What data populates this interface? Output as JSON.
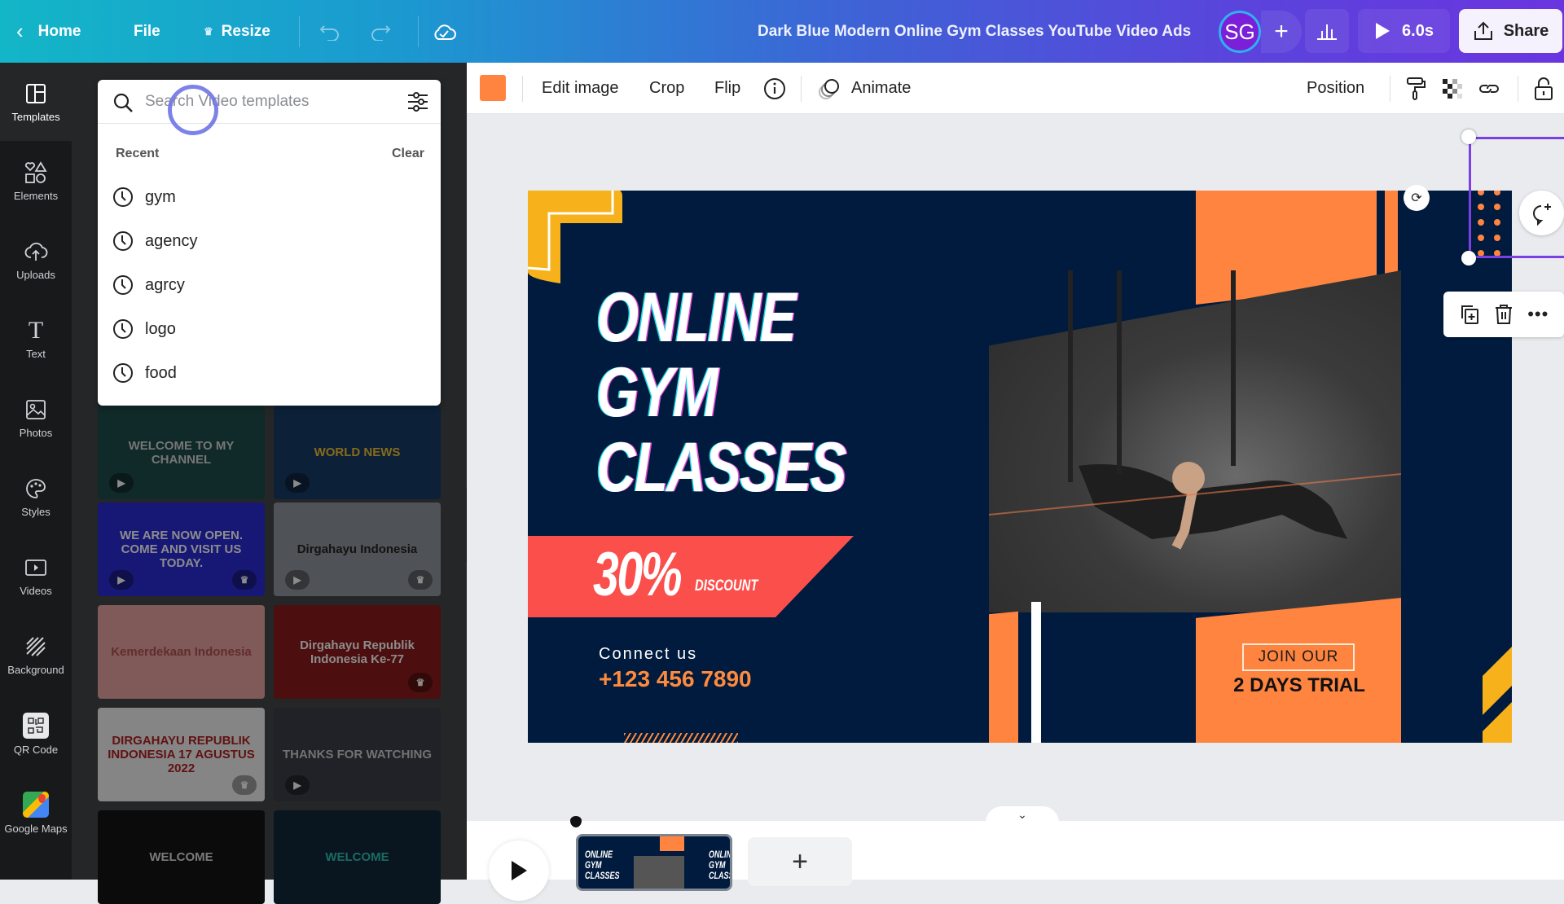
{
  "topbar": {
    "home_label": "Home",
    "file_label": "File",
    "resize_label": "Resize",
    "document_title": "Dark Blue Modern Online Gym Classes YouTube Video Ads",
    "avatar_initials": "SG",
    "play_duration": "6.0s",
    "share_label": "Share",
    "icons": [
      "chevron-left-icon",
      "crown-icon",
      "undo-icon",
      "redo-icon",
      "cloud-check-icon",
      "plus-icon",
      "stats-icon",
      "play-icon",
      "share-upload-icon"
    ]
  },
  "rail": {
    "items": [
      {
        "label": "Templates",
        "icon": "templates-icon",
        "active": true
      },
      {
        "label": "Elements",
        "icon": "elements-icon"
      },
      {
        "label": "Uploads",
        "icon": "upload-cloud-icon"
      },
      {
        "label": "Text",
        "icon": "text-icon"
      },
      {
        "label": "Photos",
        "icon": "photo-icon"
      },
      {
        "label": "Styles",
        "icon": "palette-icon"
      },
      {
        "label": "Videos",
        "icon": "video-icon"
      },
      {
        "label": "Background",
        "icon": "background-icon"
      },
      {
        "label": "QR Code",
        "icon": "qr-code-icon"
      },
      {
        "label": "Google Maps",
        "icon": "google-maps-icon"
      }
    ]
  },
  "search": {
    "placeholder": "Search Video templates",
    "value": "",
    "recent_header": "Recent",
    "clear_label": "Clear",
    "recent": [
      "gym",
      "agency",
      "agrcy",
      "logo",
      "food"
    ]
  },
  "templates": [
    {
      "text": "WELCOME TO MY CHANNEL",
      "bg": "#1d4a4a",
      "fg": "#d6d6d6",
      "play": true,
      "premium": false
    },
    {
      "text": "WORLD NEWS",
      "bg": "#163a66",
      "fg": "#f2c230",
      "play": true,
      "premium": false
    },
    {
      "text": "WE ARE NOW OPEN. COME AND VISIT US TODAY.",
      "bg": "#2a2ad6",
      "fg": "#ffffff",
      "play": true,
      "premium": true
    },
    {
      "text": "Dirgahayu Indonesia",
      "bg": "#8f969c",
      "fg": "#222222",
      "play": true,
      "premium": true
    },
    {
      "text": "Kemerdekaan Indonesia",
      "bg": "#e6a3a1",
      "fg": "#b45050",
      "play": false,
      "premium": false
    },
    {
      "text": "Dirgahayu Republik Indonesia Ke-77",
      "bg": "#8a1a1a",
      "fg": "#ffffff",
      "play": false,
      "premium": true
    },
    {
      "text": "DIRGAHAYU REPUBLIK INDONESIA 17 AGUSTUS 2022",
      "bg": "#f2f2f2",
      "fg": "#b02020",
      "play": false,
      "premium": true
    },
    {
      "text": "THANKS FOR WATCHING",
      "bg": "#3a3d48",
      "fg": "#cfcfcf",
      "play": true,
      "premium": false
    },
    {
      "text": "WELCOME",
      "bg": "#141414",
      "fg": "#dddddd",
      "play": false,
      "premium": false
    },
    {
      "text": "WELCOME",
      "bg": "#102838",
      "fg": "#2ec4b0",
      "play": false,
      "premium": false
    }
  ],
  "context_toolbar": {
    "swatch_color": "#ff8440",
    "edit_image": "Edit image",
    "crop": "Crop",
    "flip": "Flip",
    "animate": "Animate",
    "position": "Position",
    "icons": [
      "info-icon",
      "animate-icon",
      "paint-roller-icon",
      "transparency-icon",
      "link-icon",
      "unlock-icon"
    ]
  },
  "design": {
    "headline": [
      "ONLINE",
      "GYM",
      "CLASSES"
    ],
    "discount_percent": "30%",
    "discount_word": "DISCOUNT",
    "connect_label": "Connect us",
    "phone": "+123 456 7890",
    "join_label": "JOIN OUR",
    "trial_label": "2 DAYS TRIAL",
    "colors": {
      "navy": "#001b3d",
      "orange": "#ff8440",
      "red": "#fb4f4c",
      "yellow": "#f7b21b"
    }
  },
  "timeline": {
    "thumb_lines": [
      "ONLINE",
      "GYM",
      "CLASSES"
    ],
    "add_scene": "+"
  }
}
